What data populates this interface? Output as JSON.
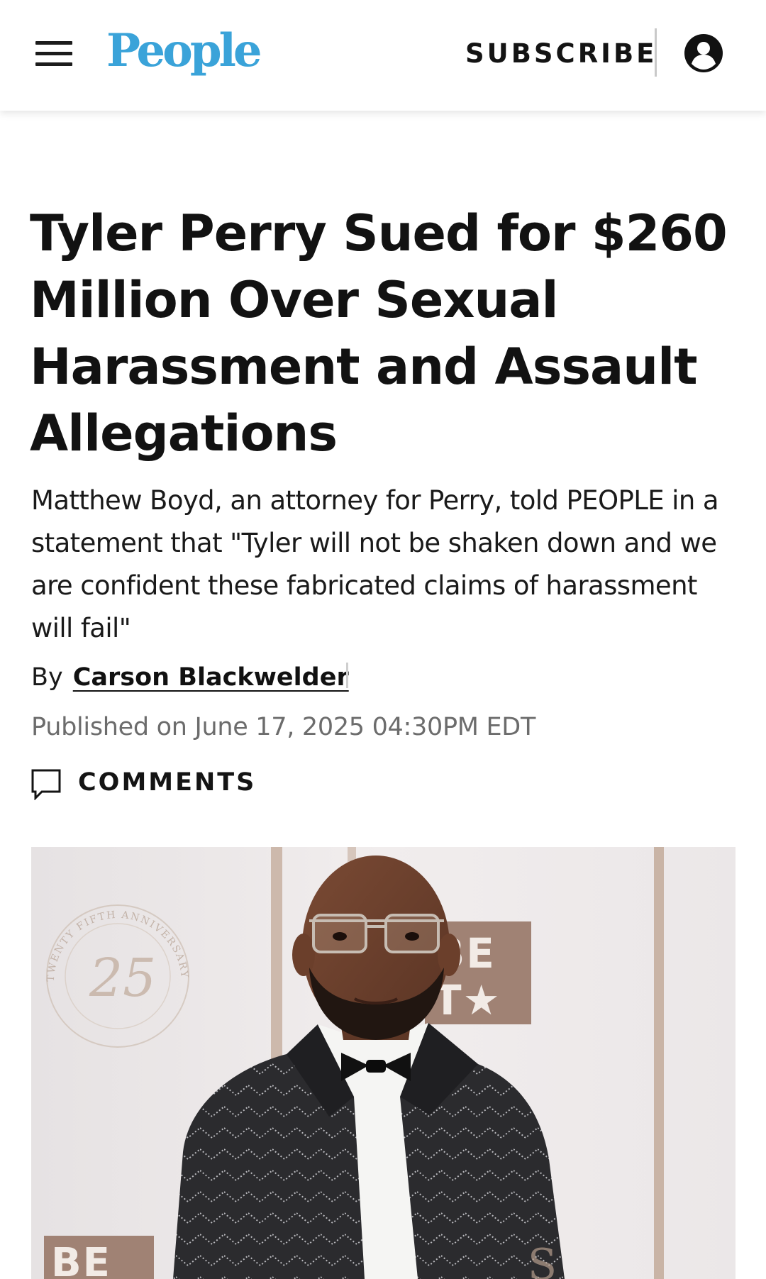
{
  "header": {
    "logo_text": "People",
    "subscribe_label": "SUBSCRIBE"
  },
  "article": {
    "headline": "Tyler Perry Sued for $260 Million Over Sexual Harassment and Assault Allegations",
    "subheadline": "Matthew Boyd, an attorney for Perry, told PEOPLE in a statement that \"Tyler will not be shaken down and we are confident these fabricated claims of harassment will fail\"",
    "byline_prefix": "By",
    "author": "Carson Blackwelder",
    "published": "Published on June 17, 2025 04:30PM EDT",
    "comments_label": "COMMENTS"
  },
  "hero_image": {
    "backdrop_logo_top": "BE",
    "backdrop_logo_bottom": "T★",
    "backdrop_logo_partial": "BE",
    "anniversary_number": "25",
    "anniversary_ring_text": "TWENTY FIFTH ANNIVERSARY"
  },
  "colors": {
    "logo_blue": "#3aa3d9",
    "text_dark": "#121212",
    "meta_gray": "#6c6c6c",
    "bet_brown": "#a08274"
  },
  "icons": {
    "menu": "hamburger-icon",
    "account": "account-icon",
    "comments": "comment-icon"
  }
}
